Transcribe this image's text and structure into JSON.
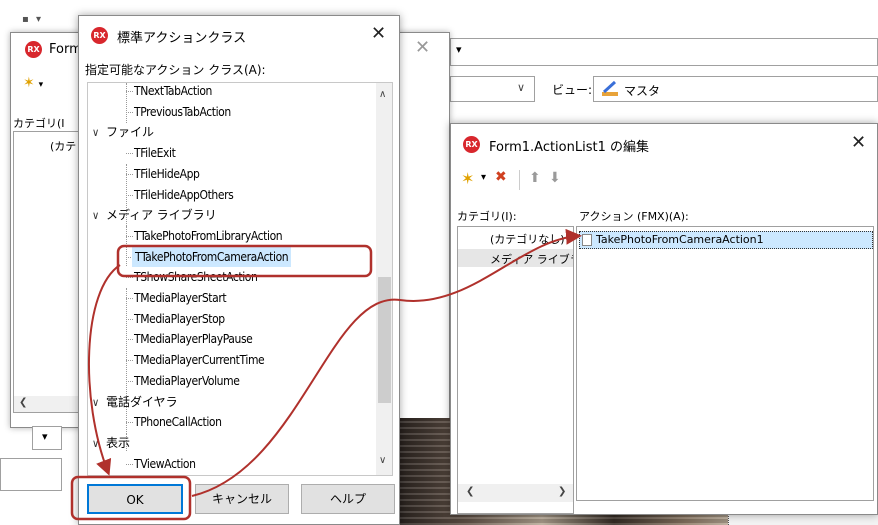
{
  "bg_form": {
    "title": "Form",
    "category_label": "カテゴリ(I",
    "category_item": "(カテ"
  },
  "ide_toolbar": {
    "view_label": "ビュー:",
    "view_value": "マスタ"
  },
  "std_dialog": {
    "title": "標準アクションクラス",
    "list_label": "指定可能なアクション クラス(A):",
    "tree": [
      {
        "type": "leaf",
        "label": "TNextTabAction"
      },
      {
        "type": "leaf",
        "label": "TPreviousTabAction"
      },
      {
        "type": "category",
        "label": "ファイル"
      },
      {
        "type": "leaf",
        "label": "TFileExit"
      },
      {
        "type": "leaf",
        "label": "TFileHideApp"
      },
      {
        "type": "leaf",
        "label": "TFileHideAppOthers"
      },
      {
        "type": "category",
        "label": "メディア ライブラリ"
      },
      {
        "type": "leaf",
        "label": "TTakePhotoFromLibraryAction"
      },
      {
        "type": "leaf",
        "label": "TTakePhotoFromCameraAction",
        "selected": true
      },
      {
        "type": "leaf",
        "label": "TShowShareSheetAction"
      },
      {
        "type": "leaf",
        "label": "TMediaPlayerStart"
      },
      {
        "type": "leaf",
        "label": "TMediaPlayerStop"
      },
      {
        "type": "leaf",
        "label": "TMediaPlayerPlayPause"
      },
      {
        "type": "leaf",
        "label": "TMediaPlayerCurrentTime"
      },
      {
        "type": "leaf",
        "label": "TMediaPlayerVolume"
      },
      {
        "type": "category",
        "label": "電話ダイヤラ"
      },
      {
        "type": "leaf",
        "label": "TPhoneCallAction"
      },
      {
        "type": "category",
        "label": "表示"
      },
      {
        "type": "leaf",
        "label": "TViewAction"
      }
    ],
    "buttons": {
      "ok": "OK",
      "cancel": "キャンセル",
      "help": "ヘルプ"
    }
  },
  "action_editor": {
    "title": "Form1.ActionList1 の編集",
    "category_header": "カテゴリ(I):",
    "action_header": "アクション (FMX)(A):",
    "categories": [
      "(カテゴリなし)",
      "メディア ライブラリ"
    ],
    "actions": [
      "TakePhotoFromCameraAction1"
    ]
  },
  "colors": {
    "highlight": "#b0312c",
    "selection": "#cce8ff",
    "rx_logo": "#d8272d"
  }
}
